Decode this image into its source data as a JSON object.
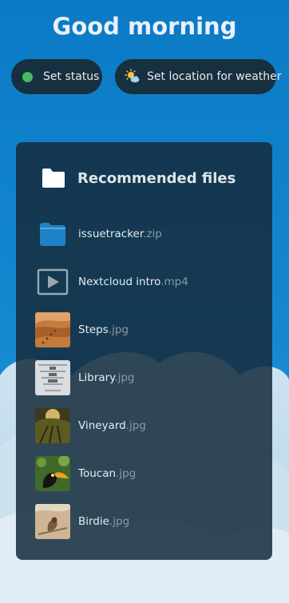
{
  "greeting": "Good morning",
  "status_buttons": {
    "status_label": "Set status",
    "weather_label": "Set location for weather"
  },
  "recommended": {
    "title": "Recommended files",
    "files": [
      {
        "name": "issuetracker",
        "ext": ".zip",
        "icon": "zip-package-icon"
      },
      {
        "name": "Nextcloud intro",
        "ext": ".mp4",
        "icon": "video-play-icon"
      },
      {
        "name": "Steps",
        "ext": ".jpg",
        "icon": "image-thumbnail"
      },
      {
        "name": "Library",
        "ext": ".jpg",
        "icon": "image-thumbnail"
      },
      {
        "name": "Vineyard",
        "ext": ".jpg",
        "icon": "image-thumbnail"
      },
      {
        "name": "Toucan",
        "ext": ".jpg",
        "icon": "image-thumbnail"
      },
      {
        "name": "Birdie",
        "ext": ".jpg",
        "icon": "image-thumbnail"
      }
    ]
  },
  "colors": {
    "background_blue": "#0a7dc8",
    "panel": "#17303f",
    "status_online": "#46ba61",
    "zip_blue": "#1e83c6"
  }
}
